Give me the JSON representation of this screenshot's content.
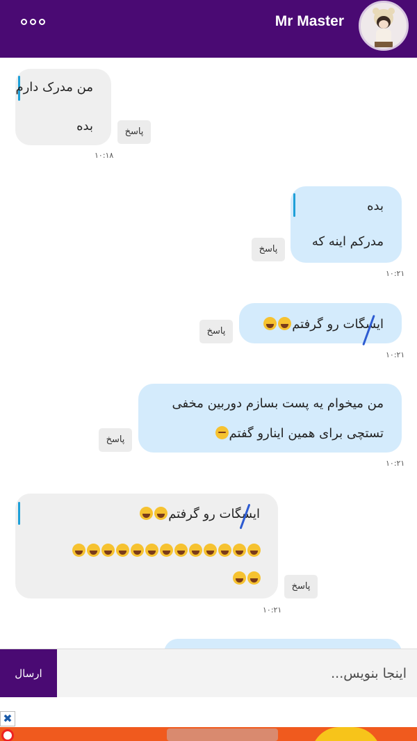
{
  "header": {
    "contact_name": "Mr Master",
    "menu_icon": "more-dots-icon",
    "color": "#4a0a73"
  },
  "reply_label": "پاسخ",
  "messages": [
    {
      "direction": "incoming",
      "quoted": "من مدرک دارم",
      "text": "بده",
      "time": "۱۰:۱۸"
    },
    {
      "direction": "outgoing",
      "quoted": "بده",
      "text": "مدرکم اینه که",
      "time": "۱۰:۲۱"
    },
    {
      "direction": "outgoing",
      "text": "ایسگات رو گرفتم",
      "emoji": [
        "rolling-laugh",
        "rolling-laugh"
      ],
      "time": "۱۰:۲۱"
    },
    {
      "direction": "outgoing",
      "line1": "من میخوام یه پست بسازم دوربین مخفی",
      "line2": "تستچی برای همین اینارو گفتم",
      "emoji": [
        "upside-down-face"
      ],
      "time": "۱۰:۲۱"
    },
    {
      "direction": "incoming",
      "quoted": "ایسگات رو گرفتم",
      "quoted_emoji": [
        "rolling-laugh",
        "rolling-laugh"
      ],
      "emoji_row_count": 13,
      "emoji_row2_count": 2,
      "emoji_name": "grinning-squint",
      "time": "۱۰:۲۱"
    }
  ],
  "composer": {
    "send_label": "ارسال",
    "placeholder": "اینجا بنویس..."
  },
  "ad": {
    "close_symbol": "✖",
    "accent": "#f05a1e"
  }
}
